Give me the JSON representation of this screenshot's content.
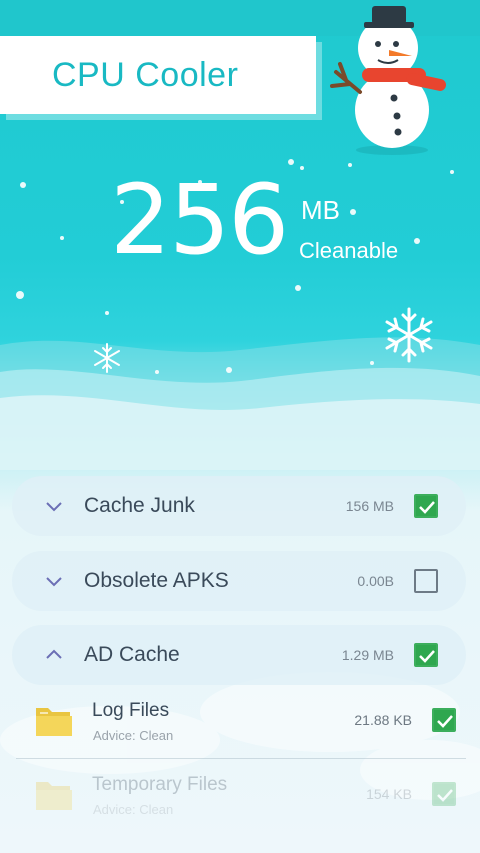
{
  "app": {
    "title": "CPU Cooler"
  },
  "summary": {
    "value": "256",
    "unit": "MB",
    "caption": "Cleanable"
  },
  "categories": [
    {
      "label": "Cache Junk",
      "size": "156 MB",
      "checked": true,
      "expanded": false
    },
    {
      "label": "Obsolete APKS",
      "size": "0.00B",
      "checked": false,
      "expanded": false
    },
    {
      "label": "AD Cache",
      "size": "1.29 MB",
      "checked": true,
      "expanded": true
    }
  ],
  "files": [
    {
      "label": "Log Files",
      "advice": "Advice: Clean",
      "size": "21.88 KB",
      "checked": true
    },
    {
      "label": "Temporary Files",
      "advice": "Advice: Clean",
      "size": "154 KB",
      "checked": true
    }
  ],
  "colors": {
    "accent": "#1fc9cf",
    "check": "#2fa74f",
    "title": "#19b9c3"
  },
  "icons": [
    "chevron-down-icon",
    "chevron-up-icon",
    "check-icon",
    "folder-icon",
    "snowman-icon",
    "snowflake-icon"
  ]
}
